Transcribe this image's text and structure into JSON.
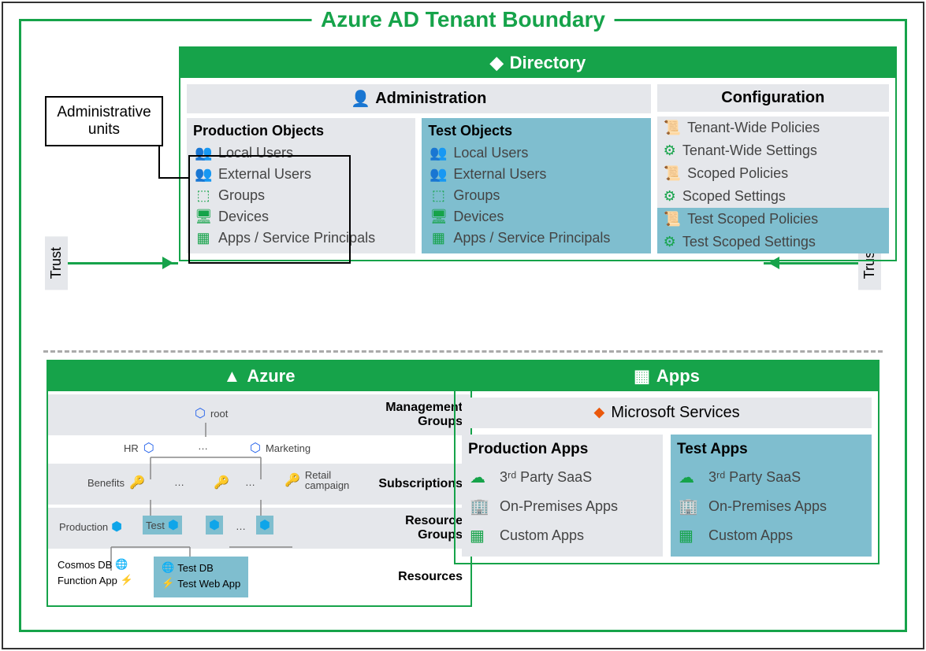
{
  "tenant_title": "Azure AD Tenant Boundary",
  "admin_units_label": "Administrative units",
  "trust_label": "Trust",
  "directory": {
    "title": "Directory",
    "administration": {
      "title": "Administration",
      "production": {
        "title": "Production Objects",
        "items": [
          "Local Users",
          "External Users",
          "Groups",
          "Devices",
          "Apps / Service Principals"
        ]
      },
      "test": {
        "title": "Test Objects",
        "items": [
          "Local Users",
          "External Users",
          "Groups",
          "Devices",
          "Apps / Service Principals"
        ]
      }
    },
    "configuration": {
      "title": "Configuration",
      "items": [
        {
          "label": "Tenant-Wide Policies",
          "icon": "scroll",
          "test": false
        },
        {
          "label": "Tenant-Wide Settings",
          "icon": "gear",
          "test": false
        },
        {
          "label": "Scoped Policies",
          "icon": "scroll",
          "test": false
        },
        {
          "label": "Scoped Settings",
          "icon": "gear",
          "test": false
        },
        {
          "label": "Test Scoped Policies",
          "icon": "scroll",
          "test": true
        },
        {
          "label": "Test Scoped Settings",
          "icon": "gear",
          "test": true
        }
      ]
    }
  },
  "azure": {
    "title": "Azure",
    "rows": [
      "Management Groups",
      "Subscriptions",
      "Resource Groups",
      "Resources"
    ],
    "mgmt": {
      "root": "root",
      "hr": "HR",
      "marketing": "Marketing"
    },
    "subs": {
      "benefits": "Benefits",
      "retail": "Retail campaign"
    },
    "rgs": {
      "production": "Production",
      "test": "Test"
    },
    "resources": {
      "cosmos": "Cosmos DB",
      "function": "Function App",
      "testdb": "Test DB",
      "testweb": "Test Web App"
    }
  },
  "apps": {
    "title": "Apps",
    "ms_services": "Microsoft Services",
    "production": {
      "title": "Production Apps",
      "items": [
        "3ʳᵈ Party SaaS",
        "On-Premises Apps",
        "Custom Apps"
      ]
    },
    "test": {
      "title": "Test Apps",
      "items": [
        "3ʳᵈ Party SaaS",
        "On-Premises Apps",
        "Custom Apps"
      ]
    }
  }
}
